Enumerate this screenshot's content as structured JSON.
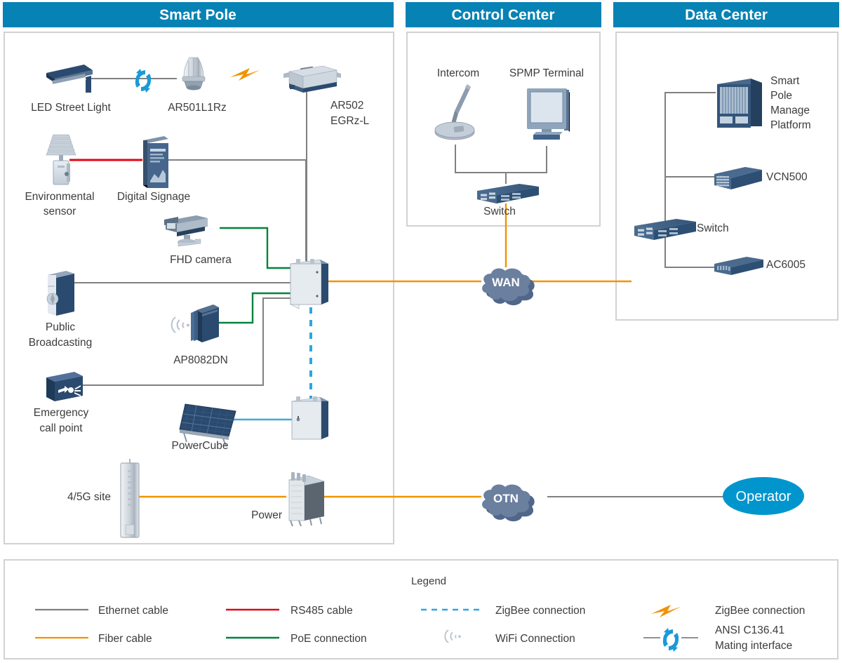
{
  "palette": {
    "header_blue": "#0782b4",
    "panel_border": "#d2d2d2",
    "ethernet": "#808080",
    "fiber": "#f39200",
    "rs485": "#e30613",
    "poe": "#00843d",
    "zigbee_line": "#2ba6e0",
    "wifi": "#b9c2cc",
    "cloud_fill": "#6b7f9e",
    "cloud_shadow": "#4f6party",
    "operator_fill": "#0095cd",
    "device_dark": "#2b4a6f",
    "device_light": "#c9d3dd",
    "text": "#3c3c3c"
  },
  "panels": [
    {
      "id": "smart-pole",
      "title": "Smart Pole"
    },
    {
      "id": "control-center",
      "title": "Control Center"
    },
    {
      "id": "data-center",
      "title": "Data Center"
    }
  ],
  "smart_pole": {
    "devices": [
      {
        "key": "led_street_light",
        "label": "LED Street Light",
        "icon": "street-light-icon"
      },
      {
        "key": "ar501",
        "label": "AR501L1Rz",
        "icon": "ar501-node-icon"
      },
      {
        "key": "ar502",
        "label": "AR502\nEGRz-L",
        "label_line1": "AR502",
        "label_line2": "EGRz-L",
        "icon": "ar502-gateway-icon"
      },
      {
        "key": "env_sensor",
        "label": "Environmental\nsensor",
        "label_line1": "Environmental",
        "label_line2": "sensor",
        "icon": "environmental-sensor-icon"
      },
      {
        "key": "digital_signage",
        "label": "Digital Signage",
        "icon": "digital-signage-icon"
      },
      {
        "key": "fhd_camera",
        "label": "FHD camera",
        "icon": "camera-icon"
      },
      {
        "key": "public_broadcasting",
        "label": "Public\nBroadcasting",
        "label_line1": "Public",
        "label_line2": "Broadcasting",
        "icon": "speaker-icon"
      },
      {
        "key": "ap8082dn",
        "label": "AP8082DN",
        "icon": "access-point-icon"
      },
      {
        "key": "emergency_call",
        "label": "Emergency\ncall point",
        "label_line1": "Emergency",
        "label_line2": "call point",
        "icon": "emergency-call-icon"
      },
      {
        "key": "powercube",
        "label": "PowerCube",
        "icon": "solar-panel-icon"
      },
      {
        "key": "site_4_5g",
        "label": "4/5G site",
        "icon": "antenna-pole-icon"
      },
      {
        "key": "power",
        "label": "Power",
        "icon": "power-cabinet-icon"
      },
      {
        "key": "main_cabinet",
        "label": "",
        "icon": "main-cabinet-icon"
      },
      {
        "key": "lower_cabinet",
        "label": "",
        "icon": "lower-cabinet-icon"
      }
    ],
    "mating_interface_icon": "ansi-mating-interface-icon",
    "zigbee_bolt_icon": "zigbee-bolt-icon",
    "wifi_waves_icon": "wifi-waves-icon"
  },
  "control_center": {
    "devices": [
      {
        "key": "intercom",
        "label": "Intercom",
        "icon": "microphone-icon"
      },
      {
        "key": "spmp_terminal",
        "label": "SPMP Terminal",
        "icon": "monitor-icon"
      },
      {
        "key": "switch",
        "label": "Switch",
        "icon": "switch-icon"
      }
    ]
  },
  "data_center": {
    "devices": [
      {
        "key": "spmp",
        "label": "Smart\nPole\nManage\nPlatform",
        "label_lines": [
          "Smart",
          "Pole",
          "Manage",
          "Platform"
        ],
        "icon": "server-rack-icon"
      },
      {
        "key": "vcn500",
        "label": "VCN500",
        "icon": "storage-server-icon"
      },
      {
        "key": "switch",
        "label": "Switch",
        "icon": "switch-icon"
      },
      {
        "key": "ac6005",
        "label": "AC6005",
        "icon": "wlan-controller-icon"
      }
    ]
  },
  "clouds": [
    {
      "key": "wan",
      "label": "WAN"
    },
    {
      "key": "otn",
      "label": "OTN"
    }
  ],
  "operator": {
    "label": "Operator"
  },
  "legend": {
    "title": "Legend",
    "items": [
      {
        "key": "ethernet",
        "label": "Ethernet cable",
        "style": "solid",
        "color": "#808080",
        "icon": "line-swatch-icon"
      },
      {
        "key": "rs485",
        "label": "RS485 cable",
        "style": "solid",
        "color": "#e30613",
        "icon": "line-swatch-icon"
      },
      {
        "key": "zigbee_dash",
        "label": "ZigBee connection",
        "style": "dashed",
        "color": "#2ba6e0",
        "icon": "dashed-line-swatch-icon"
      },
      {
        "key": "zigbee_bolt",
        "label": "ZigBee connection",
        "style": "bolt",
        "color": "#f39200",
        "icon": "zigbee-bolt-icon"
      },
      {
        "key": "fiber",
        "label": "Fiber cable",
        "style": "solid",
        "color": "#f39200",
        "icon": "line-swatch-icon"
      },
      {
        "key": "poe",
        "label": "PoE connection",
        "style": "solid",
        "color": "#00843d",
        "icon": "line-swatch-icon"
      },
      {
        "key": "wifi",
        "label": "WiFi Connection",
        "style": "waves",
        "color": "#b9c2cc",
        "icon": "wifi-waves-icon"
      },
      {
        "key": "ansi",
        "label": "ANSI C136.41\nMating interface",
        "label_line1": "ANSI C136.41",
        "label_line2": "Mating interface",
        "style": "mating",
        "color": "#2ba6e0",
        "icon": "ansi-mating-interface-icon"
      }
    ]
  }
}
